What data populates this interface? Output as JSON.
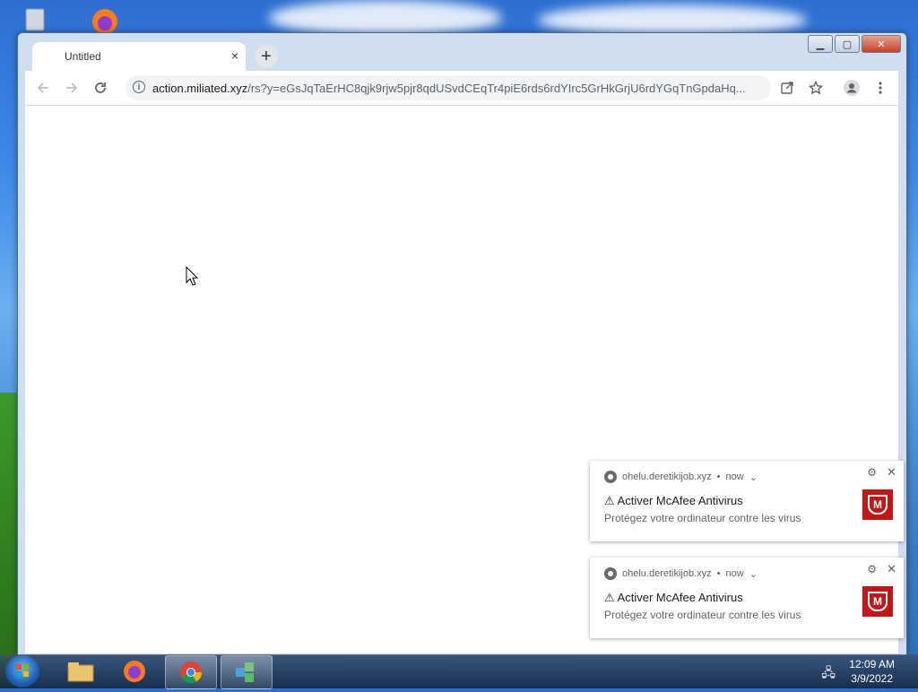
{
  "browser": {
    "tab": {
      "title": "Untitled",
      "close_glyph": "×"
    },
    "new_tab_glyph": "+",
    "url_host": "action.miliated.xyz",
    "url_path": "/rs?y=eGsJqTaErHC8qjk9rjw5pjr8qdUSvdCEqTr4piE6rds6rdYIrc5GrHkGrjU6rdYGqTnGpdaHq...",
    "icons": {
      "back": "arrow-left-icon",
      "forward": "arrow-right-icon",
      "reload": "reload-icon",
      "info": "info-icon",
      "share": "share-icon",
      "bookmark": "star-icon",
      "profile": "account-icon",
      "menu": "kebab-menu-icon"
    }
  },
  "notifications": [
    {
      "source": "ohelu.deretikijob.xyz",
      "time": "now",
      "title": "⚠ Activer McAfee Antivirus",
      "body": "Protégez votre ordinateur contre les virus"
    },
    {
      "source": "ohelu.deretikijob.xyz",
      "time": "now",
      "title": "⚠ Activer McAfee Antivirus",
      "body": "Protégez votre ordinateur contre les virus"
    }
  ],
  "taskbar": {
    "items": [
      "start-button",
      "file-explorer",
      "firefox",
      "chrome",
      "app"
    ],
    "time": "12:09 AM",
    "date": "3/9/2022"
  },
  "colors": {
    "mcafee_red": "#c01818",
    "accent": "#1a73e8"
  }
}
